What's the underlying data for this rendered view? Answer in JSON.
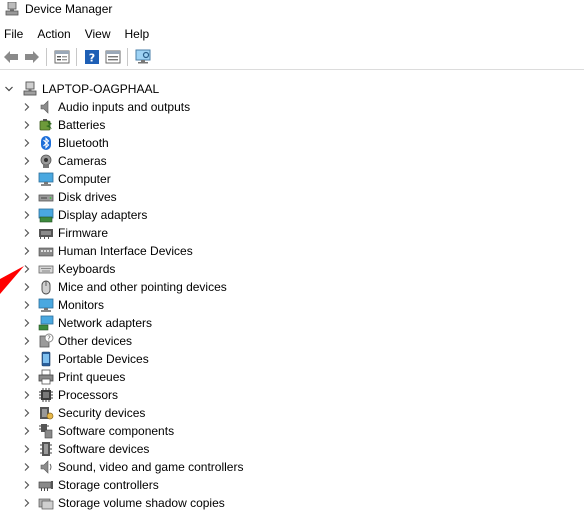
{
  "window": {
    "title": "Device Manager"
  },
  "menu": [
    "File",
    "Action",
    "View",
    "Help"
  ],
  "toolbar": [
    {
      "name": "back-icon"
    },
    {
      "name": "forward-icon"
    },
    {
      "name": "sep"
    },
    {
      "name": "properties-icon"
    },
    {
      "name": "sep"
    },
    {
      "name": "help-icon"
    },
    {
      "name": "show-hide-icon"
    },
    {
      "name": "sep"
    },
    {
      "name": "monitor-scan-icon"
    }
  ],
  "tree": {
    "root": "LAPTOP-OAGPHAAL",
    "items": [
      {
        "label": "Audio inputs and outputs",
        "icon": "speaker-icon"
      },
      {
        "label": "Batteries",
        "icon": "battery-icon"
      },
      {
        "label": "Bluetooth",
        "icon": "bluetooth-icon"
      },
      {
        "label": "Cameras",
        "icon": "camera-icon"
      },
      {
        "label": "Computer",
        "icon": "computer-icon"
      },
      {
        "label": "Disk drives",
        "icon": "disk-drive-icon"
      },
      {
        "label": "Display adapters",
        "icon": "display-adapter-icon"
      },
      {
        "label": "Firmware",
        "icon": "firmware-icon"
      },
      {
        "label": "Human Interface Devices",
        "icon": "hid-icon"
      },
      {
        "label": "Keyboards",
        "icon": "keyboard-icon"
      },
      {
        "label": "Mice and other pointing devices",
        "icon": "mouse-icon"
      },
      {
        "label": "Monitors",
        "icon": "monitor-icon"
      },
      {
        "label": "Network adapters",
        "icon": "network-adapter-icon"
      },
      {
        "label": "Other devices",
        "icon": "other-devices-icon"
      },
      {
        "label": "Portable Devices",
        "icon": "portable-device-icon"
      },
      {
        "label": "Print queues",
        "icon": "printer-icon"
      },
      {
        "label": "Processors",
        "icon": "processor-icon"
      },
      {
        "label": "Security devices",
        "icon": "security-device-icon"
      },
      {
        "label": "Software components",
        "icon": "software-component-icon"
      },
      {
        "label": "Software devices",
        "icon": "software-device-icon"
      },
      {
        "label": "Sound, video and game controllers",
        "icon": "sound-controller-icon"
      },
      {
        "label": "Storage controllers",
        "icon": "storage-controller-icon"
      },
      {
        "label": "Storage volume shadow copies",
        "icon": "shadow-copy-icon"
      }
    ]
  },
  "colors": {
    "accent": "#1e78d7",
    "annotation": "#ff0000"
  }
}
